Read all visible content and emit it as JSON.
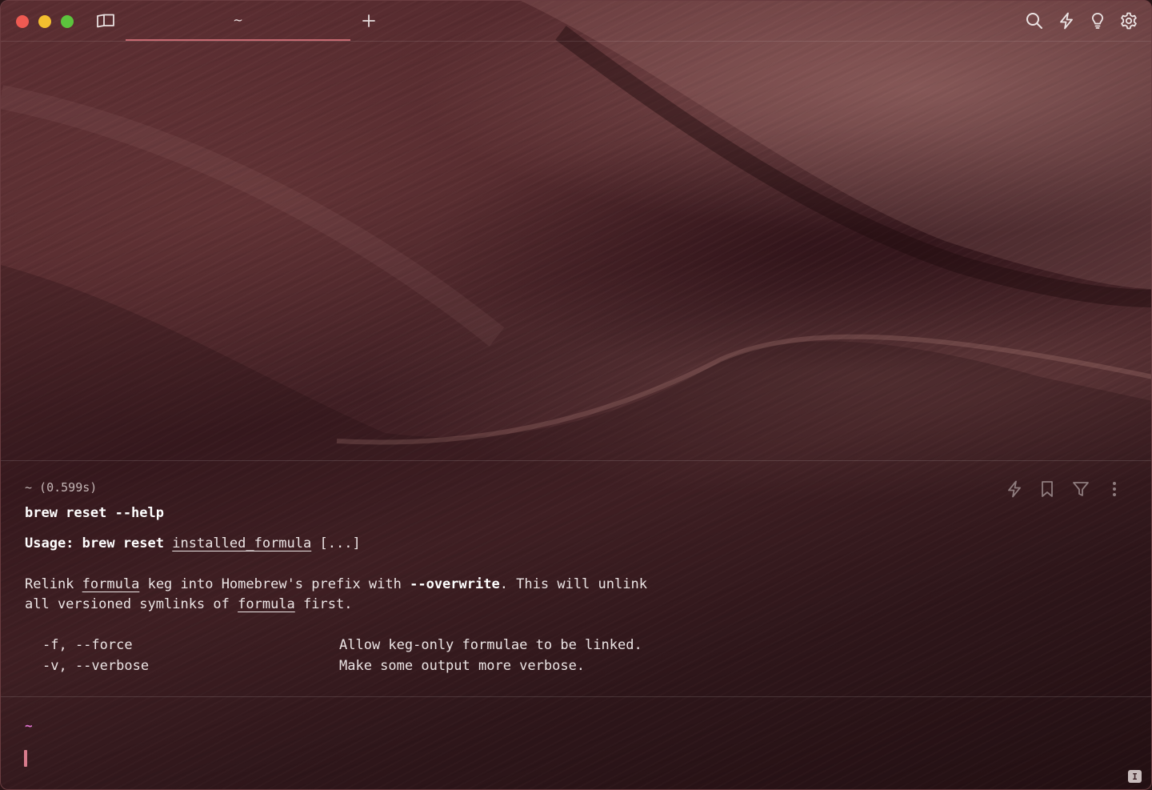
{
  "titlebar": {
    "tab_title": "~",
    "icons": [
      "sidebar-icon",
      "plus-icon",
      "search-icon",
      "lightning-icon",
      "lightbulb-icon",
      "gear-icon"
    ]
  },
  "block": {
    "meta": "~ (0.599s)",
    "command": "brew reset --help",
    "usage_label": "Usage: brew reset",
    "usage_arg": "installed_formula",
    "usage_rest": "[...]",
    "desc_line1_a": "Relink",
    "desc_line1_formula": "formula",
    "desc_line1_b": "keg into Homebrew's prefix with",
    "desc_line1_flag": "--overwrite",
    "desc_line1_c": ". This will unlink",
    "desc_line2_a": "all versioned symlinks of",
    "desc_line2_formula": "formula",
    "desc_line2_b": "first.",
    "options": [
      {
        "flag": "-f, --force",
        "description": "Allow keg-only formulae to be linked."
      },
      {
        "flag": "-v, --verbose",
        "description": "Make some output more verbose."
      }
    ],
    "icons": [
      "lightning-icon",
      "bookmark-icon",
      "filter-icon",
      "more-vertical-icon"
    ]
  },
  "prompt": {
    "directory": "~"
  },
  "input_mode_glyph": "I",
  "colors": {
    "tab_accent": "#c76971",
    "prompt_dir": "#e074d0",
    "cursor": "#d87b8c"
  }
}
